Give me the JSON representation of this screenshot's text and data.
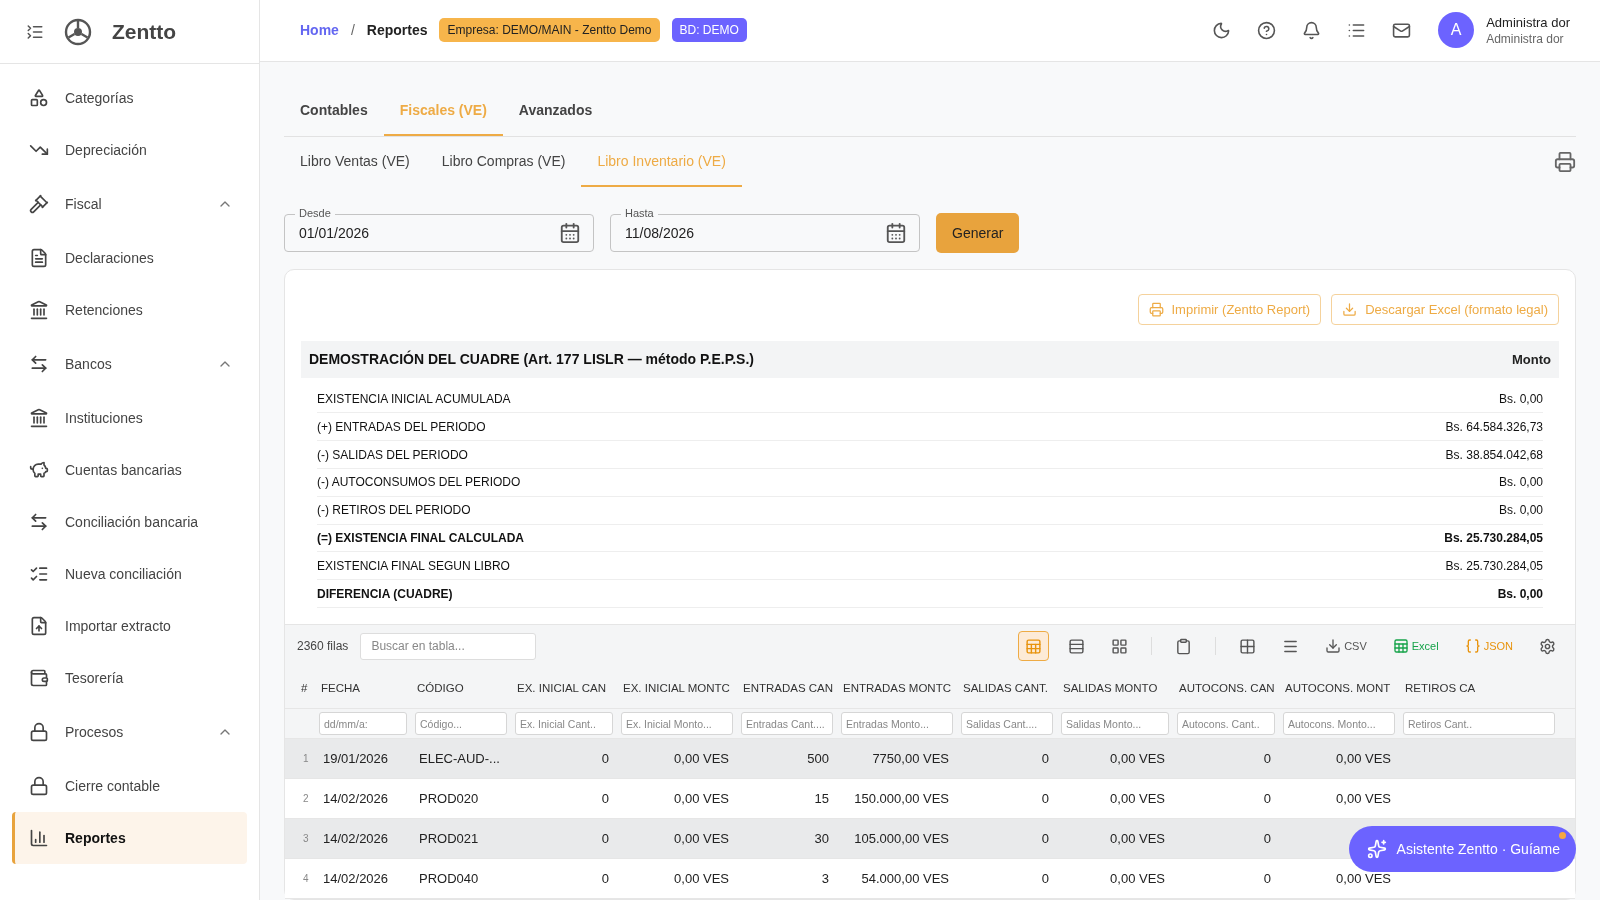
{
  "brand": {
    "name": "Zentto"
  },
  "sidebar": {
    "items": [
      {
        "label": "Categorías",
        "selected": false
      },
      {
        "label": "Depreciación",
        "selected": false
      },
      {
        "label": "Fiscal",
        "selected": false,
        "expanded": true,
        "children": [
          {
            "label": "Declaraciones",
            "selected": false
          },
          {
            "label": "Retenciones",
            "selected": false
          }
        ]
      },
      {
        "label": "Bancos",
        "selected": false,
        "expanded": true,
        "children": [
          {
            "label": "Instituciones",
            "selected": false
          },
          {
            "label": "Cuentas bancarias",
            "selected": false
          },
          {
            "label": "Conciliación bancaria",
            "selected": false
          },
          {
            "label": "Nueva conciliación",
            "selected": false
          },
          {
            "label": "Importar extracto",
            "selected": false
          },
          {
            "label": "Tesorería",
            "selected": false
          }
        ]
      },
      {
        "label": "Procesos",
        "selected": false,
        "expanded": true,
        "children": [
          {
            "label": "Cierre contable",
            "selected": false
          },
          {
            "label": "Reportes",
            "selected": true
          }
        ]
      }
    ]
  },
  "header": {
    "breadcrumb": [
      "Home",
      "Reportes"
    ],
    "breadcrumb_separator": "/",
    "company_badge": "Empresa: DEMO/MAIN - Zentto Demo",
    "db_badge": "BD: DEMO",
    "user": {
      "initial": "A",
      "name": "Administra dor",
      "role": "Administra dor"
    }
  },
  "tabs": [
    {
      "label": "Contables",
      "selected": false
    },
    {
      "label": "Fiscales (VE)",
      "selected": true
    },
    {
      "label": "Avanzados",
      "selected": false
    }
  ],
  "subtabs": [
    {
      "label": "Libro Ventas (VE)",
      "selected": false
    },
    {
      "label": "Libro Compras (VE)",
      "selected": false
    },
    {
      "label": "Libro Inventario (VE)",
      "selected": true
    }
  ],
  "filters": {
    "from": {
      "label": "Desde",
      "value": "01/01/2026"
    },
    "to": {
      "label": "Hasta",
      "value": "11/08/2026"
    },
    "button": "Generar"
  },
  "report_actions": [
    "Imprimir (Zentto Report)",
    "Descargar Excel (formato legal)"
  ],
  "summary": {
    "title": "DEMOSTRACIÓN DEL CUADRE (Art. 177 LISLR — método P.E.P.S.)",
    "amount_header": "Monto",
    "rows": [
      {
        "label": "EXISTENCIA INICIAL ACUMULADA",
        "value": "Bs. 0,00",
        "bold": false
      },
      {
        "label": "(+) ENTRADAS DEL PERIODO",
        "value": "Bs. 64.584.326,73",
        "bold": false
      },
      {
        "label": "(-) SALIDAS DEL PERIODO",
        "value": "Bs. 38.854.042,68",
        "bold": false
      },
      {
        "label": "(-) AUTOCONSUMOS DEL PERIODO",
        "value": "Bs. 0,00",
        "bold": false
      },
      {
        "label": "(-) RETIROS DEL PERIODO",
        "value": "Bs. 0,00",
        "bold": false
      },
      {
        "label": "(=) EXISTENCIA FINAL CALCULADA",
        "value": "Bs. 25.730.284,05",
        "bold": true
      },
      {
        "label": "EXISTENCIA FINAL SEGUN LIBRO",
        "value": "Bs. 25.730.284,05",
        "bold": false
      },
      {
        "label": "DIFERENCIA (CUADRE)",
        "value": "Bs. 0,00",
        "bold": true
      }
    ]
  },
  "table": {
    "row_count": "2360 filas",
    "search_placeholder": "Buscar en tabla...",
    "view_modes": [
      {
        "selected": true
      },
      {
        "selected": false
      },
      {
        "selected": false
      }
    ],
    "exports": [
      "CSV",
      "Excel",
      "JSON"
    ],
    "columns": [
      {
        "label": "#"
      },
      {
        "label": "FECHA",
        "placeholder": "dd/mm/a:"
      },
      {
        "label": "CÓDIGO",
        "placeholder": "Código..."
      },
      {
        "label": "EX. INICIAL CAN",
        "placeholder": "Ex. Inicial Cant.."
      },
      {
        "label": "EX. INICIAL MONTC",
        "placeholder": "Ex. Inicial Monto..."
      },
      {
        "label": "ENTRADAS CAN",
        "placeholder": "Entradas Cant...."
      },
      {
        "label": "ENTRADAS MONTC",
        "placeholder": "Entradas Monto..."
      },
      {
        "label": "SALIDAS CANT.",
        "placeholder": "Salidas Cant...."
      },
      {
        "label": "SALIDAS MONTO",
        "placeholder": "Salidas Monto..."
      },
      {
        "label": "AUTOCONS. CAN",
        "placeholder": "Autocons. Cant.."
      },
      {
        "label": "AUTOCONS. MONT",
        "placeholder": "Autocons. Monto..."
      },
      {
        "label": "RETIROS CA",
        "placeholder": "Retiros Cant.."
      }
    ],
    "rows": [
      [
        "1",
        "19/01/2026",
        "ELEC-AUD-...",
        "0",
        "0,00 VES",
        "500",
        "7750,00 VES",
        "0",
        "0,00 VES",
        "0",
        "0,00 VES"
      ],
      [
        "2",
        "14/02/2026",
        "PROD020",
        "0",
        "0,00 VES",
        "15",
        "150.000,00 VES",
        "0",
        "0,00 VES",
        "0",
        "0,00 VES"
      ],
      [
        "3",
        "14/02/2026",
        "PROD021",
        "0",
        "0,00 VES",
        "30",
        "105.000,00 VES",
        "0",
        "0,00 VES",
        "0"
      ],
      [
        "4",
        "14/02/2026",
        "PROD040",
        "0",
        "0,00 VES",
        "3",
        "54.000,00 VES",
        "0",
        "0,00 VES",
        "0",
        "0,00 VES"
      ]
    ]
  },
  "assistant": {
    "label": "Asistente Zentto · Guíame"
  }
}
